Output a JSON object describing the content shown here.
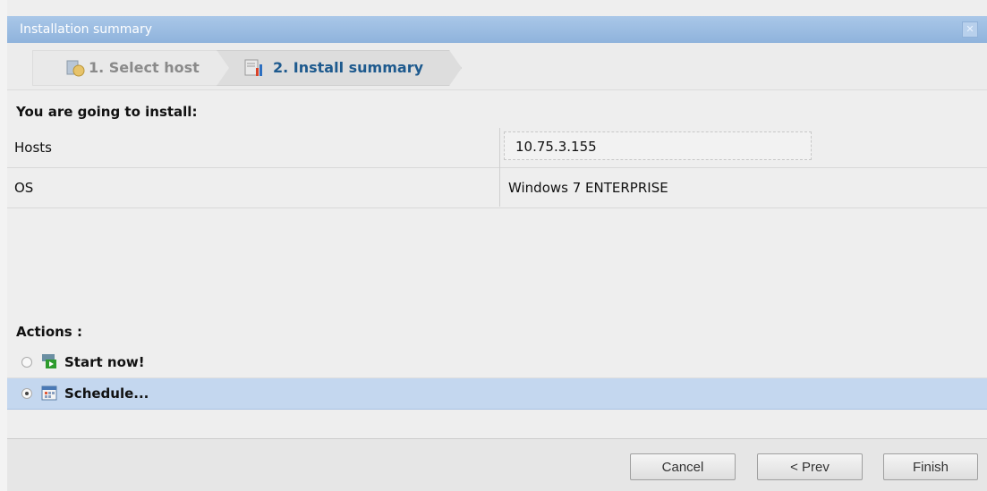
{
  "window": {
    "title": "Installation summary"
  },
  "wizard_steps": [
    {
      "label": "1. Select host",
      "state": "done"
    },
    {
      "label": "2. Install summary",
      "state": "active"
    }
  ],
  "summary": {
    "heading": "You are going to install:",
    "rows": [
      {
        "key": "Hosts",
        "value": "10.75.3.155"
      },
      {
        "key": "OS",
        "value": "Windows 7 ENTERPRISE"
      }
    ]
  },
  "actions": {
    "heading": "Actions :",
    "options": [
      {
        "label": "Start now!",
        "selected": false,
        "icon": "start-now-icon"
      },
      {
        "label": "Schedule...",
        "selected": true,
        "icon": "calendar-icon"
      }
    ]
  },
  "buttons": {
    "cancel": "Cancel",
    "prev": "< Prev",
    "finish": "Finish"
  },
  "colors": {
    "title_bar": "#9dbde3",
    "selected_row": "#c4d7ef",
    "active_step_text": "#1e5a8e"
  }
}
